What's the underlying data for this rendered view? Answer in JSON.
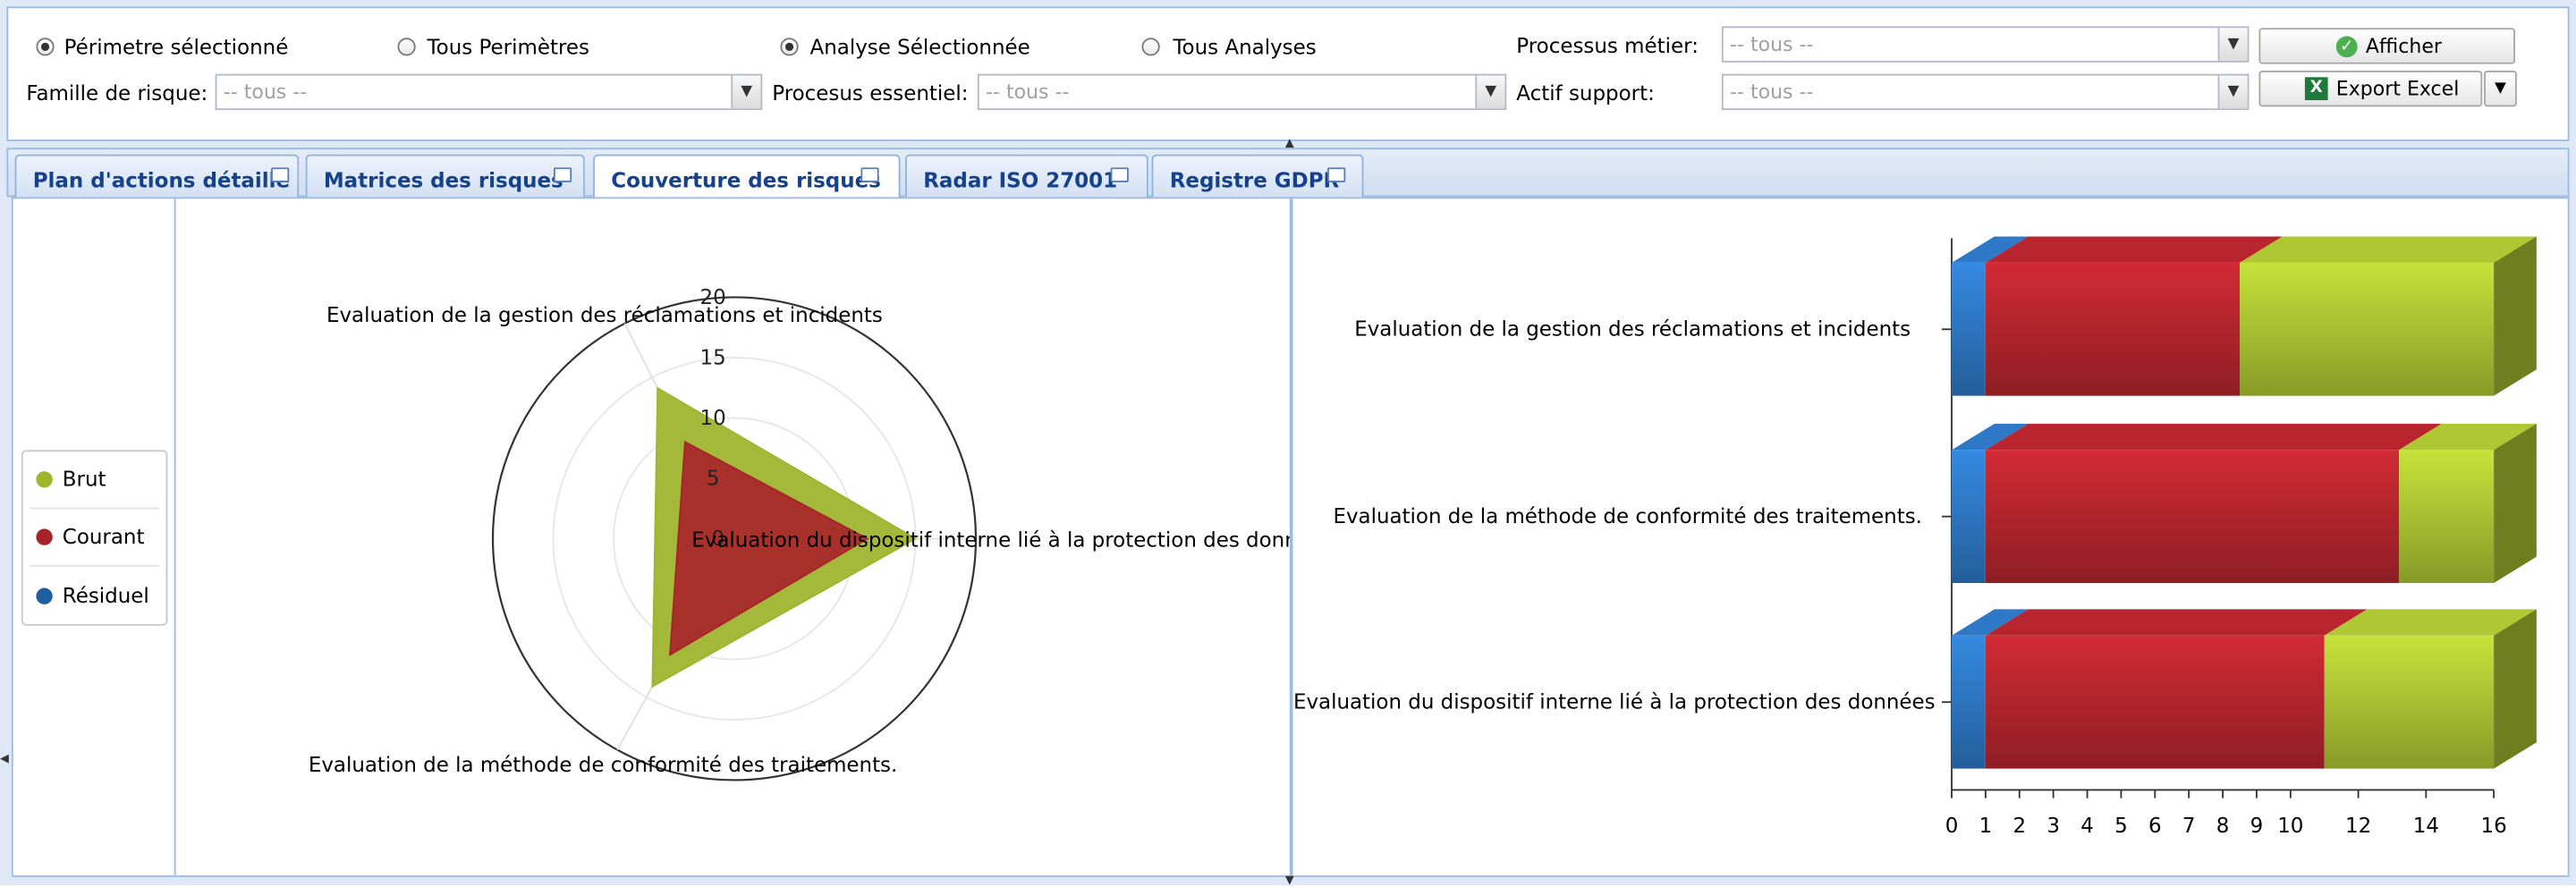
{
  "filters": {
    "radio_perimetre_selectionne": "Périmetre sélectionné",
    "radio_tous_perimetres": "Tous Perimètres",
    "radio_analyse_selectionnee": "Analyse Sélectionnée",
    "radio_tous_analyses": "Tous Analyses",
    "processus_metier_label": "Processus métier:",
    "processus_metier_value": "-- tous --",
    "famille_risque_label": "Famille de risque:",
    "famille_risque_value": "-- tous --",
    "processus_essentiel_label": "Procesus essentiel:",
    "processus_essentiel_value": "-- tous --",
    "actif_support_label": "Actif support:",
    "actif_support_value": "-- tous --",
    "afficher_label": "Afficher",
    "export_excel_label": "Export Excel"
  },
  "tabs": [
    {
      "label": "Plan d'actions détaillé",
      "active": false
    },
    {
      "label": "Matrices des risques",
      "active": false
    },
    {
      "label": "Couverture des risques",
      "active": true
    },
    {
      "label": "Radar ISO 27001",
      "active": false
    },
    {
      "label": "Registre GDPR",
      "active": false
    }
  ],
  "legend": [
    {
      "name": "Brut",
      "color": "#9fb52e"
    },
    {
      "name": "Courant",
      "color": "#a8222a"
    },
    {
      "name": "Résiduel",
      "color": "#2a6eb5"
    }
  ],
  "chart_data": [
    {
      "type": "radar",
      "axes": [
        "Evaluation de la gestion des réclamations et incidents",
        "Evaluation du dispositif interne lié à la protection des donnée",
        "Evaluation de la méthode de conformité des traitements."
      ],
      "radial_ticks": [
        "0",
        "5",
        "10",
        "15",
        "20"
      ],
      "rmax": 20,
      "series": [
        {
          "name": "Brut",
          "values": [
            14,
            15,
            14
          ]
        },
        {
          "name": "Courant",
          "values": [
            9,
            11,
            11
          ]
        },
        {
          "name": "Résiduel",
          "values": [
            0,
            0,
            0
          ]
        }
      ]
    },
    {
      "type": "bar",
      "orientation": "horizontal",
      "stacked": true,
      "categories": [
        "Evaluation de la gestion des réclamations et incidents",
        "Evaluation de la méthode de conformité des traitements.",
        "Evaluation du dispositif interne lié à la protection des données"
      ],
      "series": [
        {
          "name": "Résiduel",
          "values": [
            1,
            1,
            1
          ]
        },
        {
          "name": "Courant",
          "values": [
            7.5,
            12.2,
            10
          ]
        },
        {
          "name": "Brut",
          "values": [
            7.5,
            2.8,
            5
          ]
        }
      ],
      "x_ticks": [
        "0",
        "1",
        "2",
        "3",
        "4",
        "5",
        "6",
        "7",
        "8",
        "9",
        "10",
        "12",
        "14",
        "16"
      ],
      "xlim": [
        0,
        16
      ]
    }
  ]
}
